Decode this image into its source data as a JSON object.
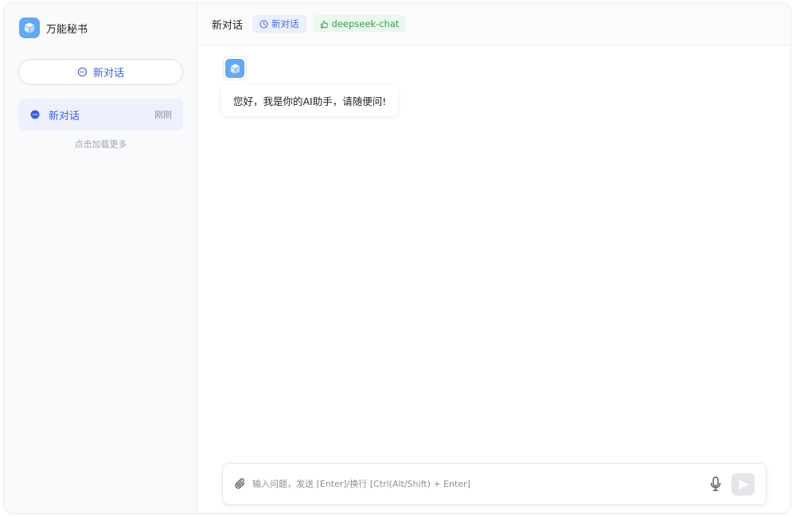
{
  "sidebar": {
    "brand_title": "万能秘书",
    "new_chat_label": "新对话",
    "conversations": [
      {
        "title": "新对话",
        "time": "刚刚"
      }
    ],
    "load_more": "点击加载更多"
  },
  "header": {
    "title": "新对话",
    "tags": [
      {
        "label": "新对话",
        "icon": "clock-icon"
      },
      {
        "label": "deepseek-chat",
        "icon": "thumbs-up-icon"
      }
    ]
  },
  "messages": [
    {
      "role": "assistant",
      "text": "您好，我是你的AI助手，请随便问!"
    }
  ],
  "composer": {
    "value": "",
    "placeholder": "输入问题，发送 [Enter]/换行 [Ctrl(Alt/Shift) + Enter]"
  },
  "colors": {
    "accent": "#3f5fd9",
    "brand_logo": "#62a8f5",
    "active_item_bg": "#eef1fd",
    "green_tag": "#3a9a56"
  }
}
